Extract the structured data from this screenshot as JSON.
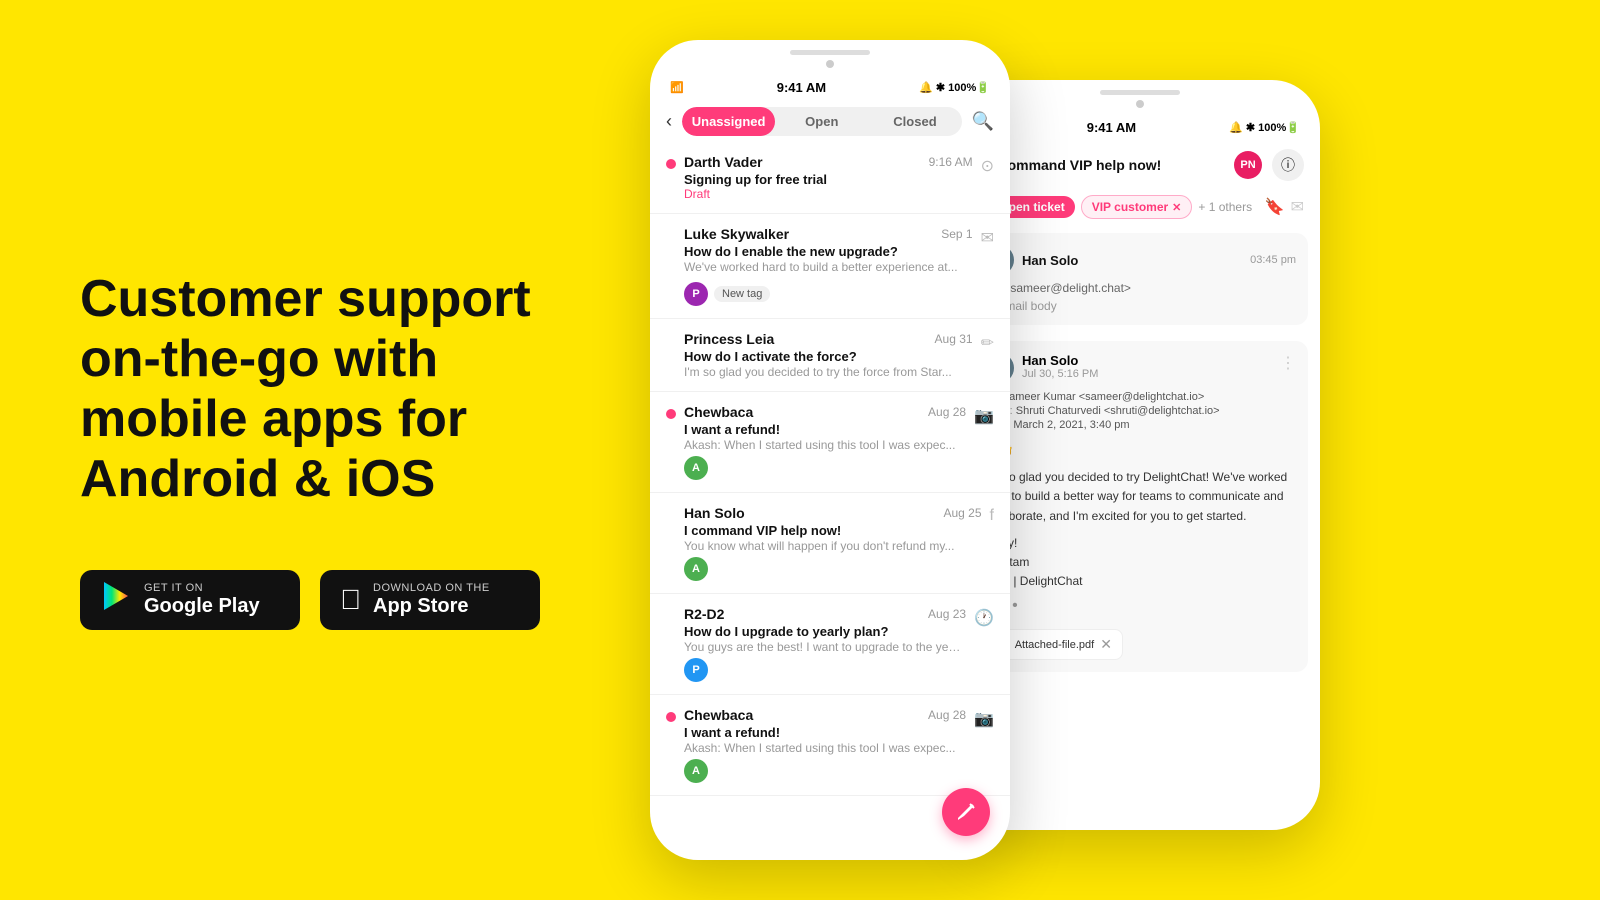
{
  "background": "#FFE600",
  "left": {
    "headline": "Customer support on-the-go with mobile apps for Android & iOS",
    "google_play": {
      "sub": "GET IT ON",
      "main": "Google Play",
      "icon": "▶"
    },
    "app_store": {
      "sub": "Download on the",
      "main": "App Store",
      "icon": ""
    }
  },
  "phone1": {
    "status_time": "9:41 AM",
    "tabs": [
      "Unassigned",
      "Open",
      "Closed"
    ],
    "active_tab": 0,
    "conversations": [
      {
        "name": "Darth Vader",
        "time": "9:16 AM",
        "subject": "Signing up for free trial",
        "preview": "Draft",
        "dot": "red",
        "icon": "draft",
        "is_draft": true
      },
      {
        "name": "Luke Skywalker",
        "time": "Sep 1",
        "subject": "How do I enable the new upgrade?",
        "preview": "We've worked hard to build a better experience at...",
        "dot": "none",
        "icon": "email",
        "tag": "New tag",
        "avatar": "P",
        "avatar_color": "purple"
      },
      {
        "name": "Princess Leia",
        "time": "Aug 31",
        "subject": "How do I activate the force?",
        "preview": "I'm so glad you decided to try the force from Star...",
        "dot": "none",
        "icon": "edit",
        "avatar": null
      },
      {
        "name": "Chewbaca",
        "time": "Aug 28",
        "subject": "I want a refund!",
        "preview": "Akash: When I started using this tool I was expec...",
        "dot": "red",
        "icon": "instagram",
        "avatar": "A",
        "avatar_color": "green"
      },
      {
        "name": "Han Solo",
        "time": "Aug 25",
        "subject": "I command VIP help now!",
        "preview": "You know what will happen if you don't refund my...",
        "dot": "none",
        "icon": "facebook",
        "avatar": "A",
        "avatar_color": "green"
      },
      {
        "name": "R2-D2",
        "time": "Aug 23",
        "subject": "How do I upgrade to yearly plan?",
        "preview": "You guys are the best! I want to upgrade to the yearly...",
        "dot": "none",
        "icon": "clock",
        "avatar": "P",
        "avatar_color": "blue"
      },
      {
        "name": "Chewbaca",
        "time": "Aug 28",
        "subject": "I want a refund!",
        "preview": "Akash: When I started using this tool I was expec...",
        "dot": "red",
        "icon": "instagram",
        "avatar": "A",
        "avatar_color": "green"
      }
    ]
  },
  "phone2": {
    "status_time": "9:41 AM",
    "conversation_title": "I command VIP help now!",
    "tags": {
      "reopen": "Reopen ticket",
      "vip": "VIP customer",
      "others": "+ 1 others"
    },
    "draft_email": {
      "sender": "Han Solo",
      "time": "03:45 pm",
      "to": "To: <sameer@delight.chat>",
      "body_preview": "Hi email body"
    },
    "full_email": {
      "sender": "Han Solo",
      "date": "Jul 30, 5:16 PM",
      "to": "Sameer Kumar <sameer@delightchat.io>",
      "from": "Shruti Chaturvedi <shruti@delightchat.io>",
      "date_full": "March 2, 2021, 3:40 pm",
      "greeting": "Hi 👋",
      "body": "I'm so glad you decided to try DelightChat! We've worked hard to build a better way for teams to communicate and collaborate, and I'm excited for you to get started.",
      "closing": "Enjoy!\nPreetam\nCEO | DelightChat",
      "attachment": "Attached-file.pdf"
    }
  }
}
